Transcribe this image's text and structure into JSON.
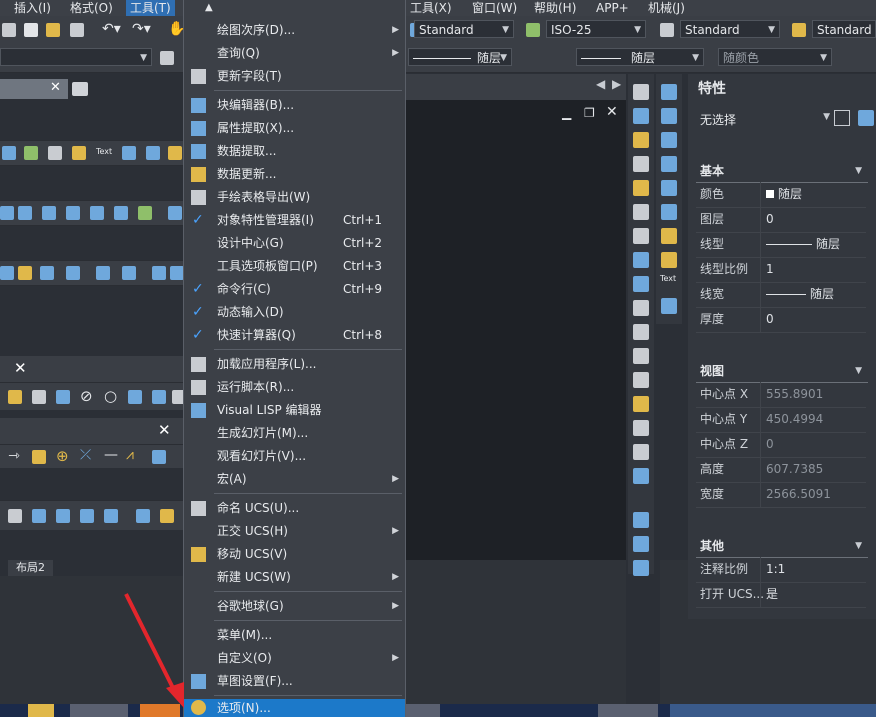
{
  "menubar": {
    "items": [
      {
        "label": "插入(I)"
      },
      {
        "label": "格式(O)"
      },
      {
        "label": "工具(T)"
      },
      {
        "label": "工具(X)"
      },
      {
        "label": "窗口(W)"
      },
      {
        "label": "APP+"
      },
      {
        "label": "机械(J)"
      },
      {
        "label": "帮助(H)"
      }
    ]
  },
  "toolbar": {
    "text_style": "Standard",
    "dim_style": "ISO-25",
    "table_style": "Standard",
    "mleader_style": "Standard",
    "linetype": "随层",
    "lineweight": "随层",
    "color": "随颜色"
  },
  "left": {
    "layout_tab": "布局2",
    "text_icon": "Text"
  },
  "menu": {
    "items": [
      {
        "label": "绘图次序(D)...",
        "shortcut": "",
        "check": false,
        "submenu": true
      },
      {
        "label": "查询(Q)",
        "shortcut": "",
        "check": false,
        "submenu": true
      },
      {
        "label": "更新字段(T)",
        "shortcut": "",
        "check": false,
        "submenu": false
      },
      {
        "label": "块编辑器(B)...",
        "shortcut": "",
        "check": false,
        "submenu": false
      },
      {
        "label": "属性提取(X)...",
        "shortcut": "",
        "check": false,
        "submenu": false
      },
      {
        "label": "数据提取...",
        "shortcut": "",
        "check": false,
        "submenu": false
      },
      {
        "label": "数据更新...",
        "shortcut": "",
        "check": false,
        "submenu": false
      },
      {
        "label": "手绘表格导出(W)",
        "shortcut": "",
        "check": false,
        "submenu": false
      },
      {
        "label": "对象特性管理器(I)",
        "shortcut": "Ctrl+1",
        "check": true,
        "submenu": false
      },
      {
        "label": "设计中心(G)",
        "shortcut": "Ctrl+2",
        "check": false,
        "submenu": false
      },
      {
        "label": "工具选项板窗口(P)",
        "shortcut": "Ctrl+3",
        "check": false,
        "submenu": false
      },
      {
        "label": "命令行(C)",
        "shortcut": "Ctrl+9",
        "check": true,
        "submenu": false
      },
      {
        "label": "动态输入(D)",
        "shortcut": "",
        "check": true,
        "submenu": false
      },
      {
        "label": "快速计算器(Q)",
        "shortcut": "Ctrl+8",
        "check": true,
        "submenu": false
      },
      {
        "label": "加载应用程序(L)...",
        "shortcut": "",
        "check": false,
        "submenu": false
      },
      {
        "label": "运行脚本(R)...",
        "shortcut": "",
        "check": false,
        "submenu": false
      },
      {
        "label": "Visual LISP 编辑器",
        "shortcut": "",
        "check": false,
        "submenu": false
      },
      {
        "label": "生成幻灯片(M)...",
        "shortcut": "",
        "check": false,
        "submenu": false
      },
      {
        "label": "观看幻灯片(V)...",
        "shortcut": "",
        "check": false,
        "submenu": false
      },
      {
        "label": "宏(A)",
        "shortcut": "",
        "check": false,
        "submenu": true
      },
      {
        "label": "命名 UCS(U)...",
        "shortcut": "",
        "check": false,
        "submenu": false
      },
      {
        "label": "正交 UCS(H)",
        "shortcut": "",
        "check": false,
        "submenu": true
      },
      {
        "label": "移动 UCS(V)",
        "shortcut": "",
        "check": false,
        "submenu": false
      },
      {
        "label": "新建 UCS(W)",
        "shortcut": "",
        "check": false,
        "submenu": true
      },
      {
        "label": "谷歌地球(G)",
        "shortcut": "",
        "check": false,
        "submenu": true
      },
      {
        "label": "菜单(M)...",
        "shortcut": "",
        "check": false,
        "submenu": false
      },
      {
        "label": "自定义(O)",
        "shortcut": "",
        "check": false,
        "submenu": true
      },
      {
        "label": "草图设置(F)...",
        "shortcut": "",
        "check": false,
        "submenu": false
      },
      {
        "label": "选项(N)...",
        "shortcut": "",
        "check": false,
        "submenu": false
      }
    ]
  },
  "props": {
    "title": "特性",
    "selection": "无选择",
    "sections": {
      "basic": "基本",
      "view": "视图",
      "other": "其他"
    },
    "basic_rows": [
      {
        "k": "颜色",
        "v": "随层"
      },
      {
        "k": "图层",
        "v": "0"
      },
      {
        "k": "线型",
        "v": "随层"
      },
      {
        "k": "线型比例",
        "v": "1"
      },
      {
        "k": "线宽",
        "v": "随层"
      },
      {
        "k": "厚度",
        "v": "0"
      }
    ],
    "view_rows": [
      {
        "k": "中心点 X",
        "v": "555.8901"
      },
      {
        "k": "中心点 Y",
        "v": "450.4994"
      },
      {
        "k": "中心点 Z",
        "v": "0"
      },
      {
        "k": "高度",
        "v": "607.7385"
      },
      {
        "k": "宽度",
        "v": "2566.5091"
      }
    ],
    "other_rows": [
      {
        "k": "注释比例",
        "v": "1:1"
      },
      {
        "k": "打开 UCS...",
        "v": "是"
      }
    ]
  },
  "colors": {
    "accent": "#1c79c9",
    "check": "#4aa3ff",
    "arrow": "#e3262c"
  }
}
